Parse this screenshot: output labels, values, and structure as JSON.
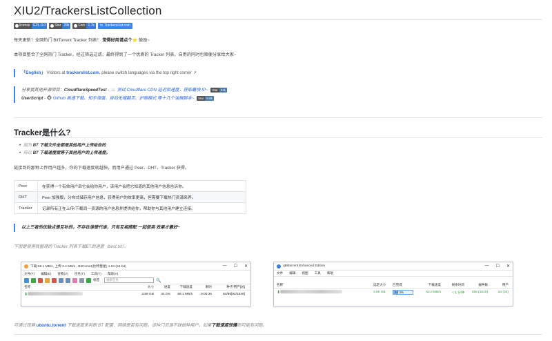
{
  "title": "XIU2/TrackersListCollection",
  "badges": [
    {
      "label": "license",
      "value": "GPL-3.0",
      "color": "#3a7bd5"
    },
    {
      "label": "Star",
      "value": "29k",
      "color": "#3a7bd5"
    },
    {
      "label": "Fork",
      "value": "1.7k",
      "color": "#3a7bd5"
    },
    {
      "label": "TrackersList.com",
      "value": "",
      "color": "#3b82f6"
    }
  ],
  "intro": {
    "line1_a": "每天更新！全网热门 BitTorrent Tracker 列表！",
    "line1_b": "觉得好用请点个",
    "line1_star": "⭐",
    "line1_c": "鼓励~",
    "line2": "本项目整合了全网热门 Tracker，经过筛选过滤，最终得到了一个优质的 Tracker 列表，自用的同时也顺便分享给大家~"
  },
  "english_quote": {
    "link_text": "「English」",
    "text": "Visitors at",
    "site": "trackerslist.com",
    "text2": ", please switch languages via the top right corner ↗"
  },
  "share_quote": {
    "line1_pre": "分享我其他开源项目：",
    "line1_name": "CloudflareSpeedTest",
    "line1_desc": "测试 Cloudflare CDN 延迟和速度，获取最快 IP~",
    "line1_star": "Star",
    "line1_count": "21k",
    "line2_name": "UserScript",
    "line2_desc": "Github 高速下载、知乎增强、自动无缝翻页、护眼模式 等十几个油猴脚本~",
    "line2_star": "Star",
    "line2_count": "8.8k"
  },
  "section": {
    "heading": "Tracker是什么?",
    "bullets": [
      {
        "pre": "因为",
        "text": "BT 下载文件全都是其他用户上传给你的"
      },
      {
        "pre": "所以",
        "text": "BT 下载速度就等于其他用户的上传速度。"
      }
    ],
    "paragraph": "链接到的那种上传用户越多，你的下载速度就越快，而用户通过 Peer、DHT、Tracker 获得。",
    "table": [
      {
        "key": "Peer",
        "value": "在获得一个有效用户后它会给你用户，该用户会把它知道的其他用户信息告诉你。"
      },
      {
        "key": "DHT",
        "value": "Peer 加强版，分布式储存用户信息，获得用户的效率更高，但需要下载热门资源来养。"
      },
      {
        "key": "Tracker",
        "value": "记录所有正在上传/下载同一资源的用户信息并提供给你，帮助你与其他用户建立连接。"
      }
    ],
    "note": "以上三者的优缺点是互补的，不存在谁替代谁，只有互相搭配 一起使用 效果才最好~",
    "caption": "下图是使用我整理的 Tracker 列表下载BT的速度（best.txt）。",
    "footer_a": "可通过观察",
    "footer_b": "ubuntu.torrent",
    "footer_c": "下载速度来判断 BT 配置、网络是否有问题，该种门资源不缺做种用户，如果",
    "footer_d": "下载速度较慢",
    "footer_e": "则可能有问题。"
  },
  "bitcomet": {
    "title": "下载:68.1 MB/s, 上传:3.4 MB/s - BitComet(比特彗星) 1.84 (64-bit)",
    "menu": [
      "文件(F)",
      "编辑(E)",
      "查看(V)",
      "任务(T)",
      "工具(T)",
      "帮助(H)"
    ],
    "tools_label": "标签",
    "search_placeholder": "搜索任务",
    "columns": [
      "名称",
      "大小",
      "进度",
      "下载速度",
      "剩时",
      "种子/用户[总]"
    ],
    "row": {
      "size": "3.59 GB",
      "progress": "34.0%",
      "speed": "68.1 MB/s",
      "eta": "0:00:35",
      "peers": "84/86[92/1546]"
    }
  },
  "qbit": {
    "title": "qBittorrent Enhanced Edition",
    "menu": [
      "文件",
      "编辑",
      "视图",
      "工具",
      "帮助"
    ],
    "columns": [
      "名称",
      "选定大小",
      "已完成",
      "下载速度",
      "剩余时间",
      "做种数",
      "用户"
    ],
    "row": {
      "size": "3.59 GB",
      "progress": "24.3%",
      "progress_value": 0.243,
      "speed": "62.0 MB/s",
      "eta": "< 1 分钟",
      "seeds": "355 (1510)",
      "peers": "34 (34)"
    }
  }
}
